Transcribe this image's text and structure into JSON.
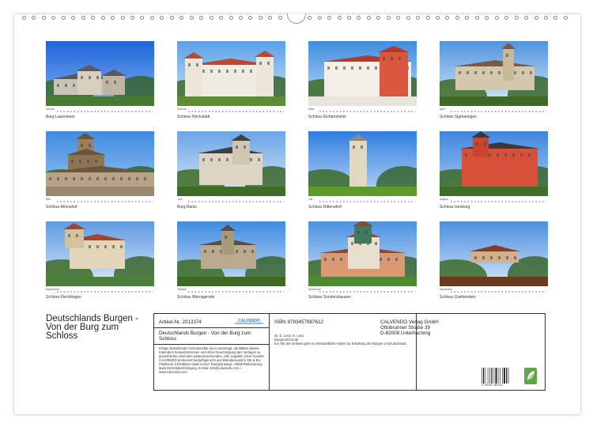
{
  "calendar": {
    "title": "Deutschlands Burgen - Von der Burg zum Schloss",
    "months": [
      {
        "month": "Januar",
        "caption": "Burg Lauenstein"
      },
      {
        "month": "Februar",
        "caption": "Schloss Höchstädt"
      },
      {
        "month": "März",
        "caption": "Schloss Eichtersheim"
      },
      {
        "month": "April",
        "caption": "Schloss Sigmaringen"
      },
      {
        "month": "Mai",
        "caption": "Schloss Almoshof"
      },
      {
        "month": "Juni",
        "caption": "Burg Ranis"
      },
      {
        "month": "Juli",
        "caption": "Schloss Rittersdorf"
      },
      {
        "month": "August",
        "caption": "Schloss Isenburg"
      },
      {
        "month": "September",
        "caption": "Schloss Flechtingen"
      },
      {
        "month": "Oktober",
        "caption": "Schloss Wernigerode"
      },
      {
        "month": "November",
        "caption": "Schloss Sondershausen"
      },
      {
        "month": "Dezember",
        "caption": "Schloss Greifenstein"
      }
    ]
  },
  "info": {
    "article": "Artikel-Nr. 2013374",
    "brand": "CALVENDO",
    "product_title": "Deutschlands Burgen - Von der Burg zum Schloss",
    "disclaimer": "Infolge bestehender Schutzrechte ist es untersagt, die Blätter dieses Kalenders herauszutrennen und ohne Genehmigung des Verlages zu gewerblichen Zwecken weiterzuverwenden. Alle Angaben ohne Gewähr. CALVENDO produziert bedarfsgerecht und klimabewusst in DE & EU. Positivere CO2-Bilanz dank kurzer Transportwege. Abfall-Reduzierung dank Einzelstückfertigung. E-Mail: info@calvendo.com • www.calvendo.com",
    "isbn": "ISBN 9783457987612",
    "authors": "Dr. D. Lenz, E. Lenz",
    "website": "Burgenarchiv.de",
    "charity": "Ein Teil des Erlöses geht in ehrenamtliche Arbeit zur Erhaltung der Burgen in Deutschland.",
    "publisher_name": "CALVENDO Verlag GmbH",
    "publisher_street": "Ottobrunner Straße 39",
    "publisher_city": "D-82008 Unterhaching",
    "barcode_number": "9 783457 987612"
  }
}
